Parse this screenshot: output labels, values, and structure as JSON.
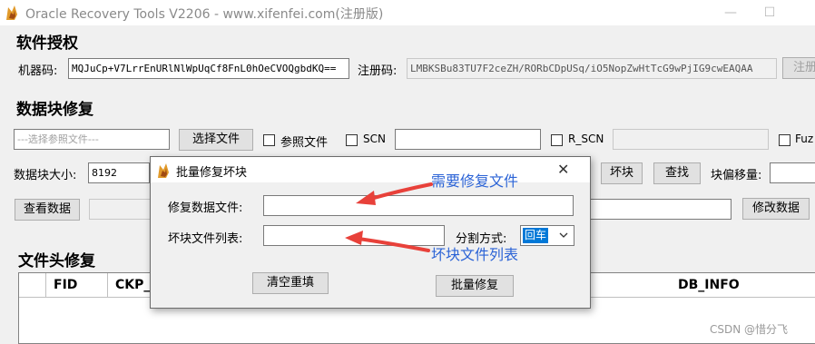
{
  "window": {
    "title": "Oracle Recovery Tools V2206 - www.xifenfei.com(注册版)",
    "min": "—",
    "max": "☐",
    "close": "✕"
  },
  "license": {
    "heading": "软件授权",
    "machine_label": "机器码:",
    "machine_code": "MQJuCp+V7LrrEnURlNlWpUqCf8FnL0hOeCVOQgbdKQ==",
    "reg_label": "注册码:",
    "reg_code": "LMBKSBu83TU7F2ceZH/RORbCDpUSq/iO5NopZwHtTcG9wPjIG9cwEAQAA",
    "reg_button": "注册"
  },
  "block_repair": {
    "heading": "数据块修复",
    "ref_file_placeholder": "---选择参照文件---",
    "select_file": "选择文件",
    "ref_file_cb": "参照文件",
    "scn_cb": "SCN",
    "rscn_cb": "R_SCN",
    "fuzzy_cb": "Fuz",
    "block_size_label": "数据块大小:",
    "block_size": "8192",
    "bad_block": "坏块",
    "find": "查找",
    "offset_label": "块偏移量:",
    "view_data": "查看数据",
    "modify_data": "修改数据"
  },
  "file_header": {
    "heading": "文件头修复",
    "columns": [
      "FID",
      "CKP_",
      "DB_INFO"
    ]
  },
  "dialog": {
    "title": "批量修复坏块",
    "close": "✕",
    "repair_file_label": "修复数据文件:",
    "bad_list_label": "坏块文件列表:",
    "split_label": "分割方式:",
    "split_value": "回车",
    "clear": "清空重填",
    "batch_repair": "批量修复"
  },
  "annotations": {
    "need_repair": "需要修复文件",
    "bad_list": "坏块文件列表"
  },
  "watermark": "CSDN @惜分飞",
  "colors": {
    "annotation": "#2b63d6",
    "arrow": "#e8413a"
  }
}
